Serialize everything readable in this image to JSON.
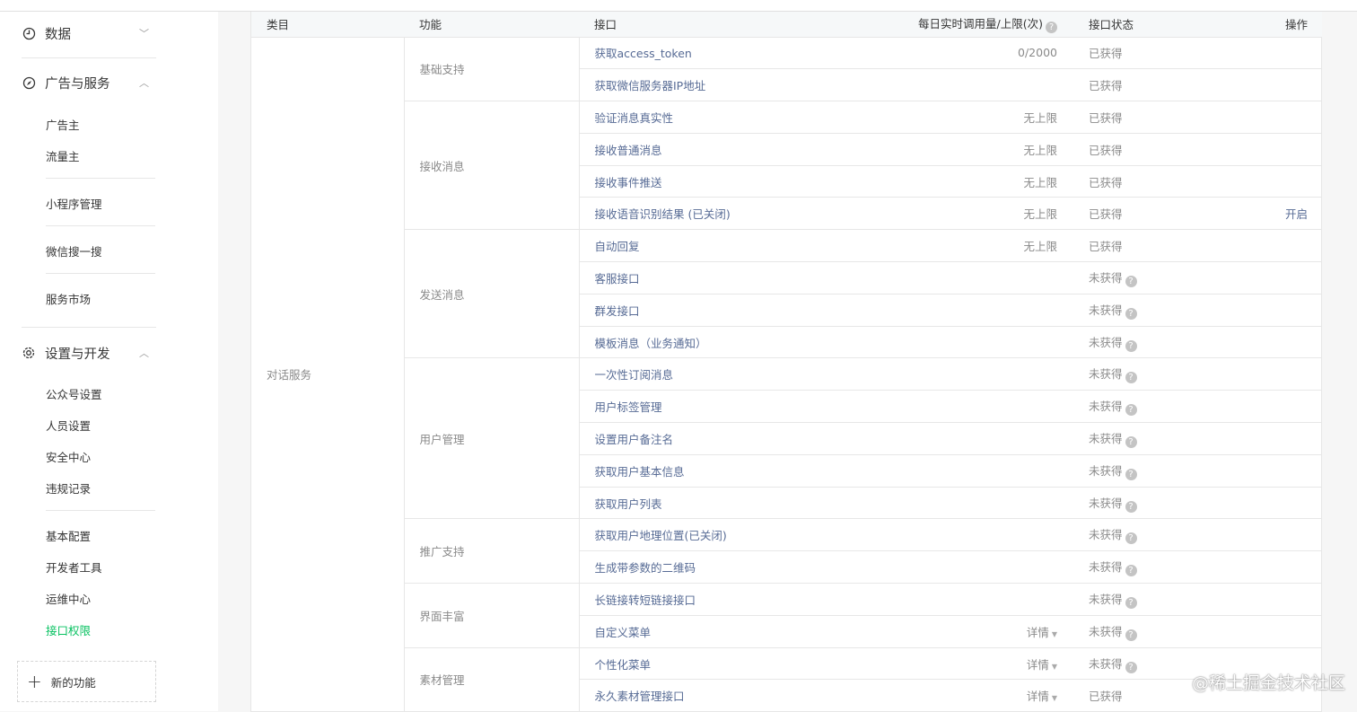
{
  "sidebar": {
    "data": "数据",
    "ads": "广告与服务",
    "advertiser": "广告主",
    "publisher": "流量主",
    "miniprogram": "小程序管理",
    "search": "微信搜一搜",
    "market": "服务市场",
    "settings": "设置与开发",
    "account": "公众号设置",
    "people": "人员设置",
    "security": "安全中心",
    "violations": "违规记录",
    "basic": "基本配置",
    "devtools": "开发者工具",
    "ops": "运维中心",
    "api": "接口权限",
    "new_feature": "新的功能"
  },
  "table": {
    "headers": {
      "category": "类目",
      "function": "功能",
      "interface": "接口",
      "quota": "每日实时调用量/上限(次)",
      "status": "接口状态",
      "action": "操作"
    },
    "category": "对话服务",
    "groups": [
      "基础支持",
      "接收消息",
      "发送消息",
      "用户管理",
      "推广支持",
      "界面丰富",
      "素材管理"
    ],
    "rows": [
      {
        "name": "获取access_token",
        "quota": "0/2000",
        "status": "已获得"
      },
      {
        "name": "获取微信服务器IP地址",
        "quota": "",
        "status": "已获得"
      },
      {
        "name": "验证消息真实性",
        "quota": "无上限",
        "status": "已获得"
      },
      {
        "name": "接收普通消息",
        "quota": "无上限",
        "status": "已获得"
      },
      {
        "name": "接收事件推送",
        "quota": "无上限",
        "status": "已获得"
      },
      {
        "name": "接收语音识别结果 (已关闭)",
        "quota": "无上限",
        "status": "已获得",
        "action": "开启"
      },
      {
        "name": "自动回复",
        "quota": "无上限",
        "status": "已获得"
      },
      {
        "name": "客服接口",
        "quota": "",
        "status": "未获得"
      },
      {
        "name": "群发接口",
        "quota": "",
        "status": "未获得"
      },
      {
        "name": "模板消息（业务通知）",
        "quota": "",
        "status": "未获得"
      },
      {
        "name": "一次性订阅消息",
        "quota": "",
        "status": "未获得"
      },
      {
        "name": "用户标签管理",
        "quota": "",
        "status": "未获得"
      },
      {
        "name": "设置用户备注名",
        "quota": "",
        "status": "未获得"
      },
      {
        "name": "获取用户基本信息",
        "quota": "",
        "status": "未获得"
      },
      {
        "name": "获取用户列表",
        "quota": "",
        "status": "未获得"
      },
      {
        "name": "获取用户地理位置(已关闭)",
        "quota": "",
        "status": "未获得"
      },
      {
        "name": "生成带参数的二维码",
        "quota": "",
        "status": "未获得"
      },
      {
        "name": "长链接转短链接接口",
        "quota": "",
        "status": "未获得"
      },
      {
        "name": "自定义菜单",
        "quota": "详情",
        "status": "未获得"
      },
      {
        "name": "个性化菜单",
        "quota": "详情",
        "status": "未获得"
      },
      {
        "name": "永久素材管理接口",
        "quota": "详情",
        "status": "已获得"
      }
    ]
  },
  "watermark": "@稀土掘金技术社区",
  "colors": {
    "active": "#07c160",
    "link": "#576b95"
  }
}
